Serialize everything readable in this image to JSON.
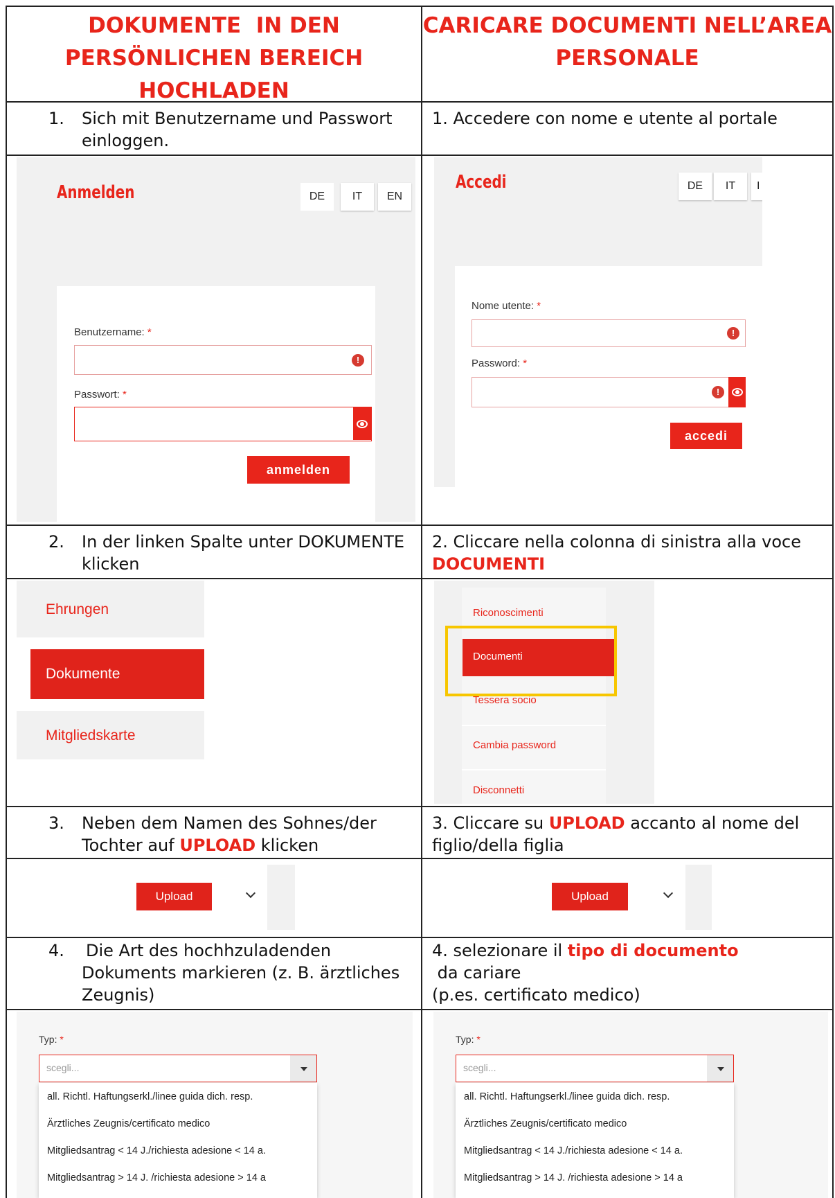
{
  "headers": {
    "de": [
      "DOKUMENTE  IN DEN",
      "PERSÖNLICHEN BEREICH",
      "HOCHLADEN"
    ],
    "it": [
      "CARICARE DOCUMENTI NELL’AREA",
      "PERSONALE"
    ]
  },
  "steps": {
    "s1": {
      "de_num": "1.",
      "de_lines": [
        "Sich mit Benutzername und Passwort",
        "einloggen."
      ],
      "it_text": "1. Accedere con nome e utente al portale"
    },
    "s2": {
      "de_num": "2.",
      "de_lines": [
        "In der linken Spalte unter DOKUMENTE",
        "klicken"
      ],
      "it_line1": "2. Cliccare nella colonna di sinistra alla voce",
      "it_line2": "DOCUMENTI"
    },
    "s3": {
      "de_num": "3.",
      "de_line1": "Neben dem Namen des Sohnes/der",
      "de_line2_pre": "Tochter auf ",
      "de_line2_red": "UPLOAD",
      "de_line2_post": " klicken",
      "it_line1_pre": "3. Cliccare su ",
      "it_line1_red": "UPLOAD",
      "it_line1_post": " accanto al nome del",
      "it_line2": "figlio/della figlia"
    },
    "s4": {
      "de_num": "4.",
      "de_lines": [
        "Die Art des hochhzuladenden",
        "Dokuments markieren (z. B. ärztliches",
        "Zeugnis)"
      ],
      "it_line1_pre": "4. selezionare il ",
      "it_line1_red": "tipo di documento",
      "it_line1_post": " da cariare",
      "it_line2": "(p.es. certificato medico)"
    }
  },
  "login_de": {
    "title": "Anmelden",
    "langs": [
      "DE",
      "IT",
      "EN"
    ],
    "user_label": "Benutzername:",
    "pass_label": "Passwort:",
    "required": "*",
    "error_icon": "!",
    "submit": "anmelden"
  },
  "login_it": {
    "title": "Accedi",
    "langs": [
      "DE",
      "IT",
      "I"
    ],
    "user_label": "Nome utente:",
    "pass_label": "Password:",
    "required": "*",
    "error_icon": "!",
    "submit": "accedi"
  },
  "menu_de": {
    "items": [
      "Ehrungen",
      "Dokumente",
      "Mitgliedskarte"
    ]
  },
  "menu_it": {
    "items": [
      "Riconoscimenti",
      "Documenti",
      "Tessera socio",
      "Cambia password",
      "Disconnetti"
    ]
  },
  "upload": {
    "label": "Upload"
  },
  "select": {
    "label": "Typ:",
    "required": "*",
    "placeholder": "scegli...",
    "options": [
      "all. Richtl. Haftungserkl./linee guida dich. resp.",
      "Ärztliches Zeugnis/certificato medico",
      "Mitgliedsantrag < 14 J./richiesta adesione < 14 a.",
      "Mitgliedsantrag > 14 J. /richiesta adesione > 14 a"
    ]
  },
  "colors": {
    "accent": "#e8251b",
    "highlight": "#f7c600",
    "panel": "#f1f1f1"
  }
}
